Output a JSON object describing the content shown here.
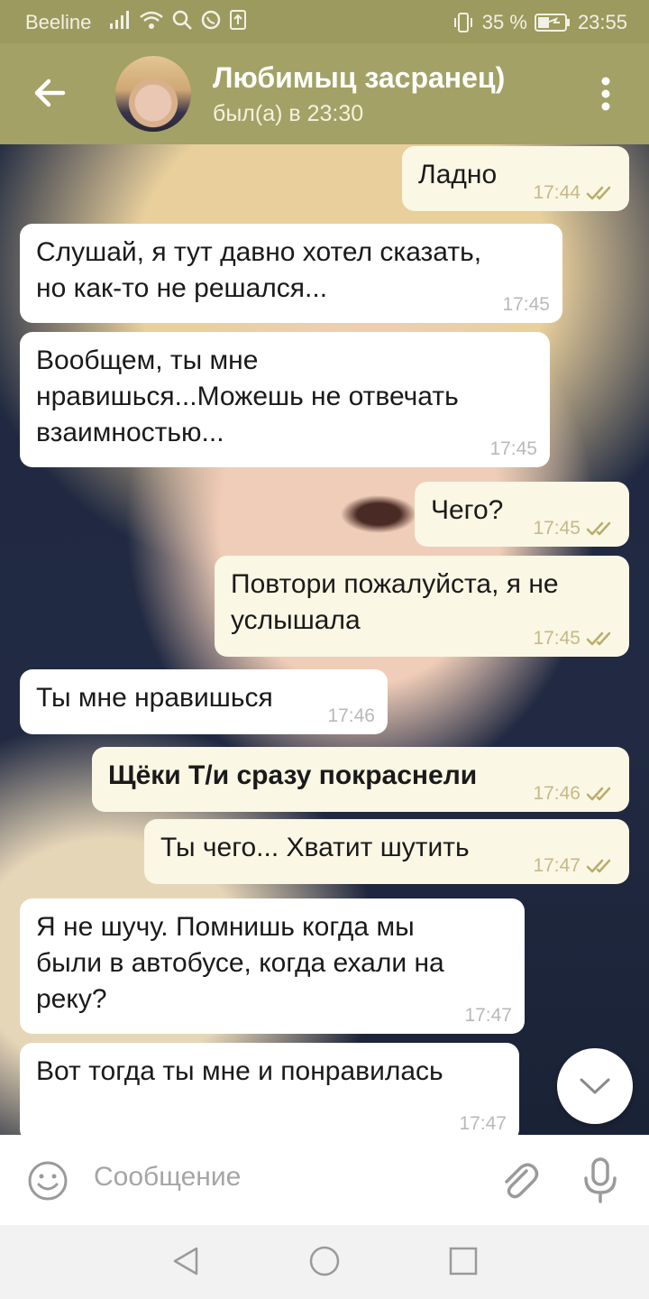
{
  "status_bar": {
    "carrier": "Beeline",
    "battery": "35 %",
    "time": "23:55"
  },
  "header": {
    "contact_name": "Любимыц засранец)",
    "last_seen": "был(а) в 23:30"
  },
  "messages": [
    {
      "direction": "outgoing",
      "text": "Ладно",
      "time": "17:44",
      "read": true,
      "bold": false
    },
    {
      "direction": "incoming",
      "text": "Слушай, я тут давно хотел сказать,\nно как-то не решался...",
      "time": "17:45"
    },
    {
      "direction": "incoming",
      "text": "Вообщем, ты мне\nнравишься...Можешь не отвечать\nвзаимностью...",
      "time": "17:45"
    },
    {
      "direction": "outgoing",
      "text": "Чего?",
      "time": "17:45",
      "read": true,
      "bold": false
    },
    {
      "direction": "outgoing",
      "text": "Повтори пожалуйста, я не\nуслышала",
      "time": "17:45",
      "read": true,
      "bold": false
    },
    {
      "direction": "incoming",
      "text": "Ты мне нравишься",
      "time": "17:46"
    },
    {
      "direction": "outgoing",
      "text": "Щёки Т/и сразу покраснели",
      "time": "17:46",
      "read": true,
      "bold": true
    },
    {
      "direction": "outgoing",
      "text": "Ты чего... Хватит шутить",
      "time": "17:47",
      "read": true,
      "bold": false
    },
    {
      "direction": "incoming",
      "text": "Я не шучу. Помнишь когда мы\nбыли в автобусе, когда ехали на\nреку?",
      "time": "17:47"
    },
    {
      "direction": "incoming",
      "text": "Вот тогда ты мне и понравилась",
      "time": "17:47"
    }
  ],
  "input": {
    "placeholder": "Сообщение"
  },
  "colors": {
    "header": "#a3a165",
    "incoming_bubble": "#ffffff",
    "outgoing_bubble": "#faf7e4",
    "read_check": "#b8ad6a"
  },
  "icons": {
    "back": "back-arrow-icon",
    "menu": "more-vertical-icon",
    "emoji": "emoji-icon",
    "attach": "paperclip-icon",
    "mic": "microphone-icon",
    "scroll": "chevron-down-icon"
  }
}
